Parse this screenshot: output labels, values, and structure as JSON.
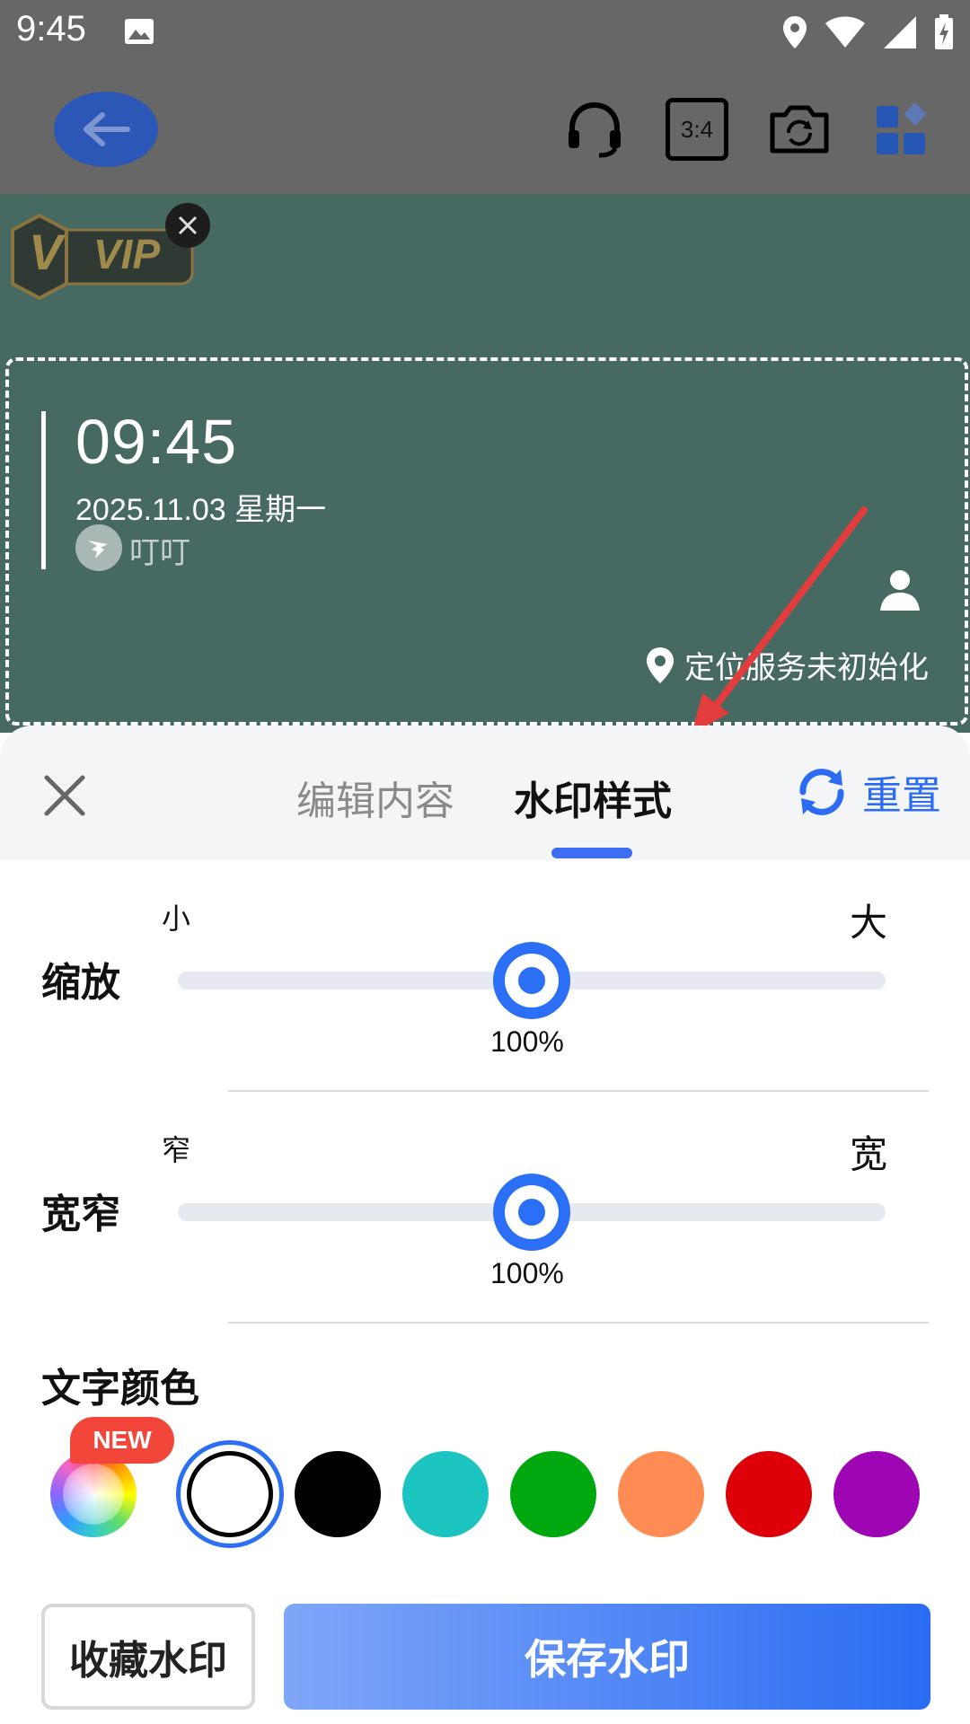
{
  "status_bar": {
    "time": "9:45",
    "icons": [
      "image-icon",
      "location-icon",
      "wifi-icon",
      "signal-icon",
      "battery-charging-icon"
    ]
  },
  "toolbar": {
    "back_icon": "arrow-left-icon",
    "headset_icon": "headset-icon",
    "ratio_label": "3:4",
    "camera_switch_icon": "camera-switch-icon",
    "apps_icon": "apps-grid-icon"
  },
  "preview": {
    "vip_badge": "VIP",
    "vip_letter": "V",
    "watermark": {
      "time": "09:45",
      "date": "2025.11.03 星期一",
      "brand": "叮叮",
      "location": "定位服务未初始化"
    }
  },
  "sheet": {
    "tabs": [
      {
        "label": "编辑内容",
        "active": false
      },
      {
        "label": "水印样式",
        "active": true
      }
    ],
    "reset_label": "重置",
    "scale": {
      "label": "缩放",
      "min_label": "小",
      "max_label": "大",
      "value_text": "100%",
      "position": 0.5
    },
    "width": {
      "label": "宽窄",
      "min_label": "窄",
      "max_label": "宽",
      "value_text": "100%",
      "position": 0.5
    },
    "text_color": {
      "title": "文字颜色",
      "new_badge": "NEW",
      "colors": [
        "#ffffff",
        "#000000",
        "#1cc4bf",
        "#00a80f",
        "#ff8c55",
        "#dd0009",
        "#9e05b2"
      ],
      "selected": "#ffffff"
    },
    "buttons": {
      "collect": "收藏水印",
      "save": "保存水印"
    },
    "accent_color": "#2b6ff6"
  }
}
